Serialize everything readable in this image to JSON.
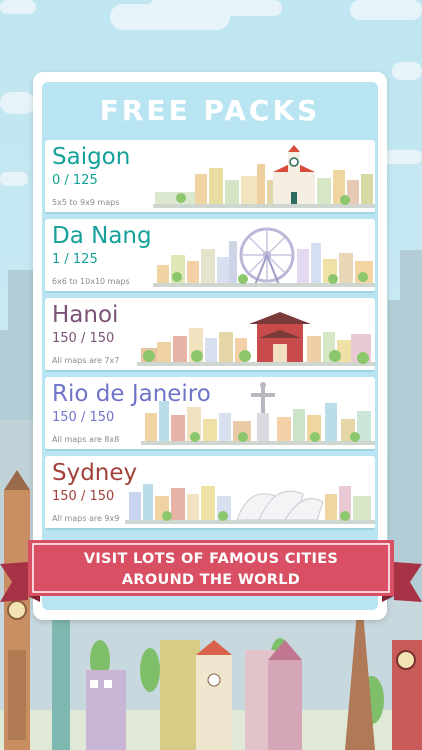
{
  "colors": {
    "sky": "#c7e8f2",
    "panel_inner": "#b9e5f2",
    "teal": "#16a09a",
    "purple": "#7a5278",
    "periwinkle": "#6f74c8",
    "brick": "#a3403a",
    "banner": "#d94f63",
    "banner_dark": "#a63345"
  },
  "panel": {
    "title": "FREE PACKS"
  },
  "packs": [
    {
      "name": "Saigon",
      "progress": "0 / 125",
      "desc": "5x5 to 9x9 maps",
      "color": "#16a09a"
    },
    {
      "name": "Da Nang",
      "progress": "1 / 125",
      "desc": "6x6 to 10x10 maps",
      "color": "#16a09a"
    },
    {
      "name": "Hanoi",
      "progress": "150 / 150",
      "desc": "All maps are 7x7",
      "color": "#7a5278"
    },
    {
      "name": "Rio de Janeiro",
      "progress": "150 / 150",
      "desc": "All maps are 8x8",
      "color": "#6f74c8"
    },
    {
      "name": "Sydney",
      "progress": "150 / 150",
      "desc": "All maps are 9x9",
      "color": "#a3403a"
    }
  ],
  "banner": {
    "line1": "VISIT LOTS OF FAMOUS CITIES",
    "line2": "AROUND THE WORLD"
  },
  "icons": {
    "saigon": "saigon-skyline-icon",
    "danang": "danang-ferris-wheel-icon",
    "hanoi": "hanoi-temple-icon",
    "rio": "christ-the-redeemer-icon",
    "sydney": "sydney-opera-house-icon"
  }
}
